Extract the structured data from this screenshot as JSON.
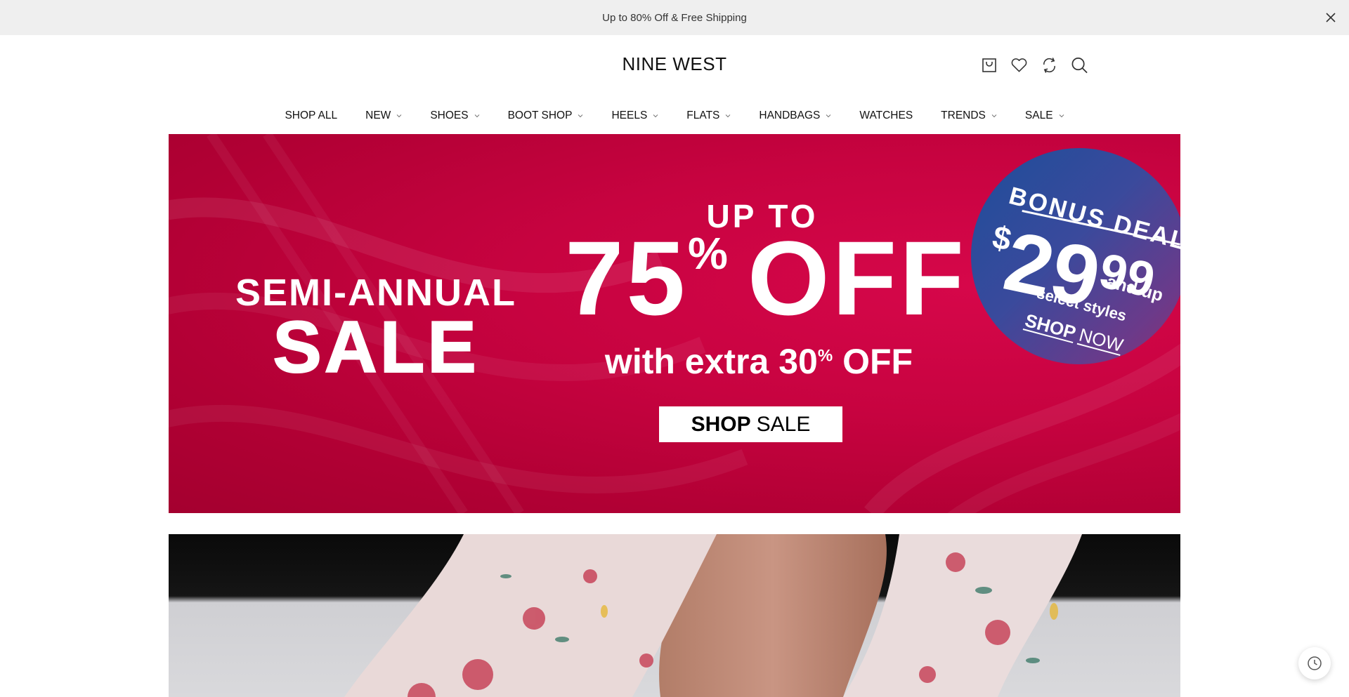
{
  "announcement": {
    "text": "Up to 80% Off & Free Shipping"
  },
  "header": {
    "logo": "NINE WEST",
    "icons": [
      "cart-icon",
      "wishlist-heart-icon",
      "compare-refresh-icon",
      "search-icon"
    ]
  },
  "nav": {
    "items": [
      {
        "label": "SHOP ALL",
        "has_dropdown": false
      },
      {
        "label": "NEW",
        "has_dropdown": true
      },
      {
        "label": "SHOES",
        "has_dropdown": true
      },
      {
        "label": "BOOT SHOP",
        "has_dropdown": true
      },
      {
        "label": "HEELS",
        "has_dropdown": true
      },
      {
        "label": "FLATS",
        "has_dropdown": true
      },
      {
        "label": "HANDBAGS",
        "has_dropdown": true
      },
      {
        "label": "WATCHES",
        "has_dropdown": false
      },
      {
        "label": "TRENDS",
        "has_dropdown": true
      },
      {
        "label": "SALE",
        "has_dropdown": true
      }
    ]
  },
  "hero": {
    "semi_annual": "SEMI-ANNUAL",
    "sale": "SALE",
    "up_to": "UP TO",
    "discount_number": "75",
    "discount_symbol": "%",
    "discount_word": "OFF",
    "extra_prefix": "with extra 30",
    "extra_symbol": "%",
    "extra_suffix": "OFF",
    "button_bold": "SHOP",
    "button_regular": "SALE",
    "bonus": {
      "title": "BONUS DEAL",
      "dollar": "$",
      "price_main": "29",
      "price_cents": "99",
      "and_up": "and up",
      "select_styles": "select styles",
      "shop_bold": "SHOP",
      "shop_regular": "NOW"
    },
    "colors": {
      "background": "#c70340",
      "bonus_circle": "#3a4a9c"
    }
  },
  "floating": {
    "icon": "recently-viewed-clock-icon"
  }
}
